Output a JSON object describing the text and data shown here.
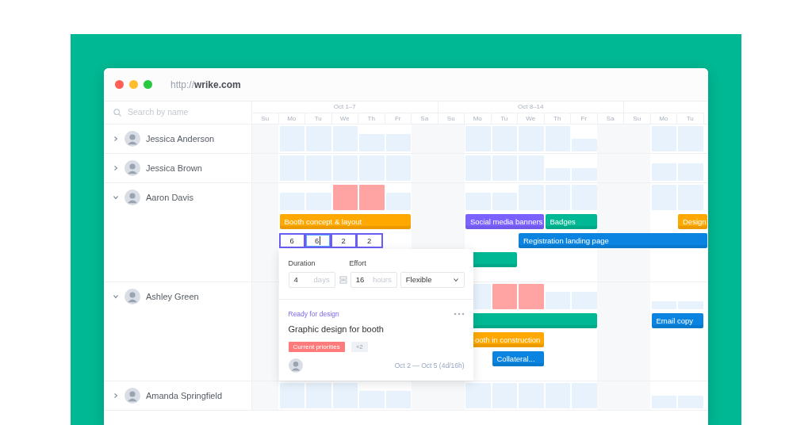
{
  "browser": {
    "url": "http://**wrike.com**"
  },
  "search": {
    "placeholder": "Search by name"
  },
  "weeks": [
    {
      "label": "Oct 1–7",
      "days": [
        "Su",
        "Mo",
        "Tu",
        "We",
        "Th",
        "Fr",
        "Sa"
      ]
    },
    {
      "label": "Oct 8–14",
      "days": [
        "Su",
        "Mo",
        "Tu",
        "We",
        "Th",
        "Fr",
        "Sa"
      ]
    },
    {
      "days": [
        "Su",
        "Mo",
        "Tu"
      ]
    }
  ],
  "people": [
    {
      "name": "Jessica Anderson",
      "expanded": false,
      "load": [
        {
          "level": 1,
          "over": false
        },
        {
          "level": 1,
          "over": false
        },
        {
          "level": 1,
          "over": false
        },
        {
          "level": 0.7,
          "over": false
        },
        {
          "level": 0.7,
          "over": false
        },
        {
          "level": 1,
          "over": false
        },
        {
          "level": 1,
          "over": false
        },
        {
          "level": 1,
          "over": false
        },
        {
          "level": 1,
          "over": false
        },
        {
          "level": 0.5,
          "over": false
        },
        {
          "level": 1,
          "over": false
        },
        {
          "level": 1,
          "over": false
        }
      ]
    },
    {
      "name": "Jessica Brown",
      "expanded": false,
      "load": [
        {
          "level": 1,
          "over": false
        },
        {
          "level": 1,
          "over": false
        },
        {
          "level": 1,
          "over": false
        },
        {
          "level": 1,
          "over": false
        },
        {
          "level": 1,
          "over": false
        },
        {
          "level": 1,
          "over": false
        },
        {
          "level": 1,
          "over": false
        },
        {
          "level": 1,
          "over": false
        },
        {
          "level": 0.5,
          "over": false
        },
        {
          "level": 0.5,
          "over": false
        },
        {
          "level": 0.7,
          "over": false
        },
        {
          "level": 0.7,
          "over": false
        }
      ]
    },
    {
      "name": "Aaron Davis",
      "expanded": true,
      "load": [
        {
          "level": 0.7,
          "over": false
        },
        {
          "level": 0.7,
          "over": false
        },
        {
          "level": 1,
          "over": true
        },
        {
          "level": 1,
          "over": true
        },
        {
          "level": 0.7,
          "over": false
        },
        {
          "level": 0.7,
          "over": false
        },
        {
          "level": 0.7,
          "over": false
        },
        {
          "level": 1,
          "over": false
        },
        {
          "level": 1,
          "over": false
        },
        {
          "level": 1,
          "over": false
        },
        {
          "level": 1,
          "over": false
        },
        {
          "level": 1,
          "over": false
        }
      ],
      "tracks": [
        [
          {
            "kind": "bar",
            "label": "Booth concept & layout",
            "color": "#ffa800"
          },
          {
            "kind": "bar",
            "label": "Social media banners",
            "color": "#7b61ff"
          },
          {
            "kind": "bar",
            "label": "Badges",
            "color": "#00b894"
          },
          {
            "kind": "bar",
            "label": "Design",
            "color": "#ffa800"
          }
        ],
        [
          {
            "kind": "effort",
            "values": [
              {
                "value": "6",
                "focused": false
              },
              {
                "value": "6",
                "focused": true
              },
              {
                "value": "2",
                "focused": false
              },
              {
                "value": "2",
                "focused": false
              }
            ],
            "details": {
              "duration": {
                "label": "Duration",
                "value": "4",
                "unit": "days"
              },
              "effort": {
                "label": "Effort",
                "value": "16",
                "unit": "hours"
              },
              "mode": "Flexible",
              "status": "Ready for design",
              "title": "Graphic design for booth",
              "tags": [
                {
                  "label": "Current priorities",
                  "color": "#ff7a7a"
                },
                {
                  "label": "+2",
                  "color": "#eef1f5"
                }
              ],
              "dates": "Oct 2 — Oct 5 (4d/16h)"
            }
          },
          {
            "kind": "bar",
            "label": "Registration landing page",
            "color": "#0a84e0"
          }
        ],
        [
          {
            "kind": "bar",
            "color": "#00b894"
          }
        ]
      ]
    },
    {
      "name": "Ashley Green",
      "expanded": true,
      "load": [
        {
          "level": 1,
          "over": false
        },
        {
          "level": 1,
          "over": true
        },
        {
          "level": 1,
          "over": true
        },
        {
          "level": 0.7,
          "over": false
        },
        {
          "level": 0.7,
          "over": false
        },
        {
          "level": 0.3,
          "over": false
        },
        {
          "level": 0.3,
          "over": false
        }
      ],
      "tracks": [
        [
          {
            "kind": "bar",
            "color": "#00b894"
          },
          {
            "kind": "bar",
            "label": "Email copy",
            "color": "#0a84e0"
          }
        ],
        [
          {
            "kind": "bar",
            "label": "ooth in construction",
            "color": "#ffa800"
          }
        ],
        [
          {
            "kind": "bar",
            "label": "Collateral...",
            "color": "#0a84e0"
          }
        ]
      ]
    },
    {
      "name": "Amanda Springfield",
      "expanded": false,
      "load": [
        {
          "level": 1,
          "over": false
        },
        {
          "level": 1,
          "over": false
        },
        {
          "level": 1,
          "over": false
        },
        {
          "level": 0.7,
          "over": false
        },
        {
          "level": 0.7,
          "over": false
        },
        {
          "level": 1,
          "over": false
        },
        {
          "level": 1,
          "over": false
        },
        {
          "level": 1,
          "over": false
        },
        {
          "level": 1,
          "over": false
        },
        {
          "level": 1,
          "over": false
        },
        {
          "level": 0.5,
          "over": false
        },
        {
          "level": 0.5,
          "over": false
        }
      ]
    }
  ]
}
